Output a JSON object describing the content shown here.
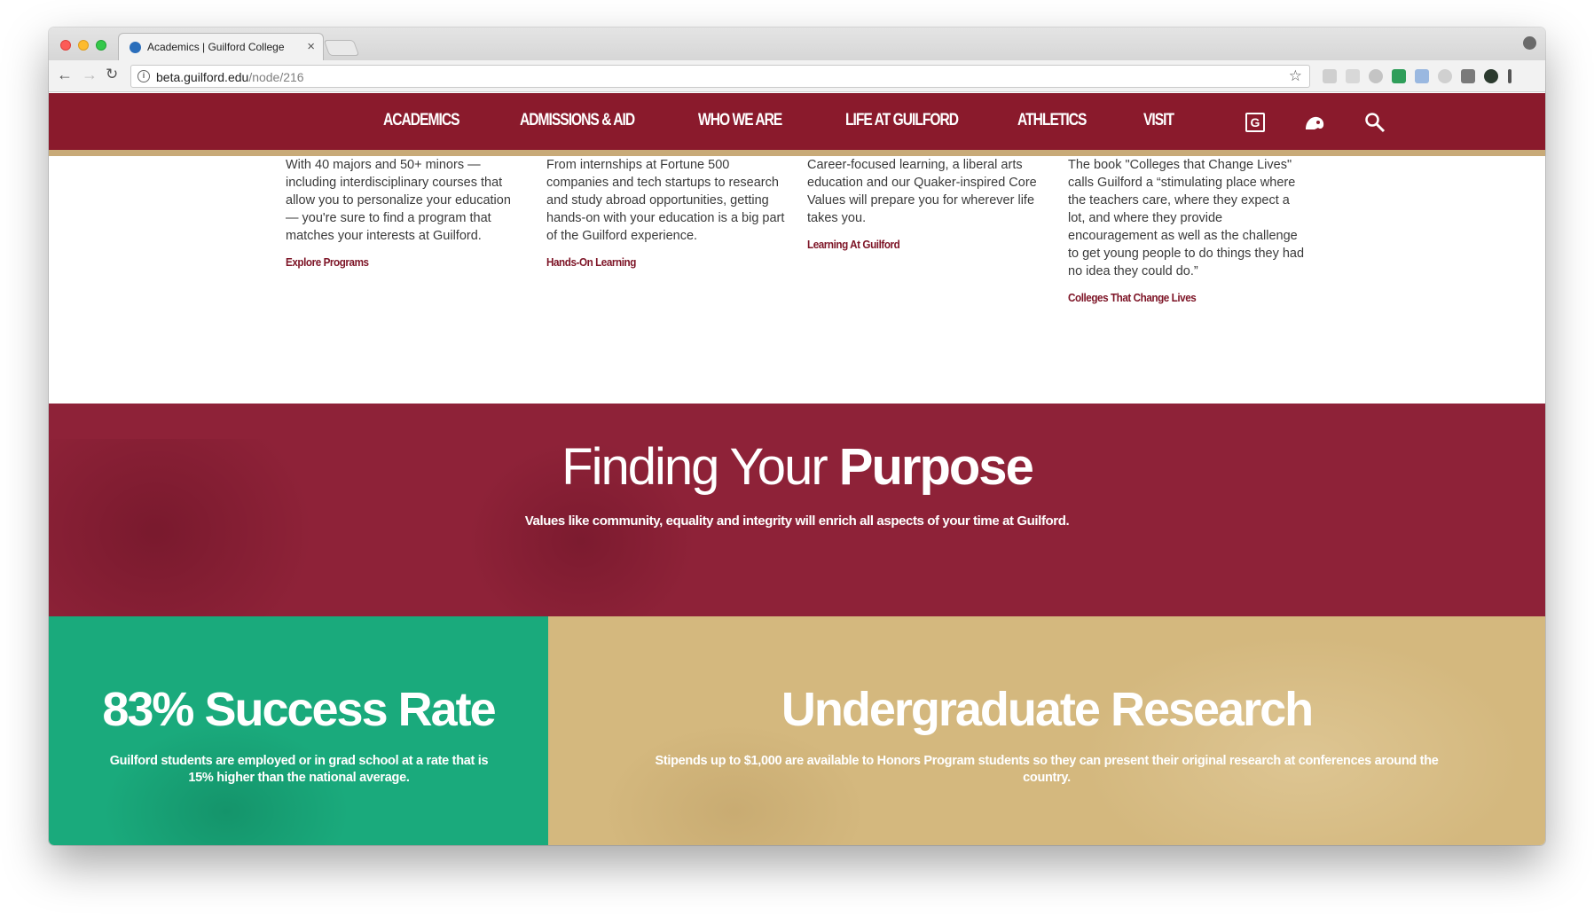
{
  "browser": {
    "tab_title": "Academics | Guilford College",
    "tab_close": "×",
    "url_host": "beta.guilford.edu",
    "url_path": "/node/216",
    "info_icon": "i",
    "back_icon": "←",
    "forward_icon": "→",
    "reload_icon": "↻",
    "star_icon": "☆"
  },
  "nav": {
    "items": [
      "ACADEMICS",
      "ADMISSIONS & AID",
      "WHO WE ARE",
      "LIFE AT GUILFORD",
      "ATHLETICS",
      "VISIT"
    ],
    "g_icon": "G"
  },
  "columns": [
    {
      "text": "With 40 majors and 50+ minors — including interdisciplinary courses that allow you to personalize your education — you're sure to find a program that matches your interests at Guilford.",
      "link": "Explore Programs"
    },
    {
      "text": "From internships at Fortune 500 companies and tech startups to research and study abroad opportunities, getting hands-on with your education is a big part of the Guilford experience.",
      "link": "Hands-On Learning"
    },
    {
      "text": "Career-focused learning, a liberal arts education and our Quaker-inspired Core Values will prepare you for wherever life takes you.",
      "link": "Learning At Guilford"
    },
    {
      "text": "The book \"Colleges that Change Lives\" calls Guilford a “stimulating place where the teachers care, where they expect a lot, and where they provide encouragement as well as the challenge to get young people to do things they had no idea they could do.”",
      "link": "Colleges That Change Lives"
    }
  ],
  "purpose": {
    "title_light": "Finding Your ",
    "title_bold": "Purpose",
    "subtitle": "Values like community, equality and integrity will enrich all aspects of your time at Guilford."
  },
  "success": {
    "title_bold": "83%",
    "title_light": " Success Rate",
    "subtitle": "Guilford students are employed or in grad school at a rate that is 15% higher than the national average."
  },
  "research": {
    "title_light": "Undergraduate ",
    "title_bold": "Research",
    "subtitle": "Stipends up to $1,000 are available to Honors Program students so they can present their original research at conferences around the country."
  },
  "colors": {
    "brand_maroon": "#8a1a2c",
    "accent_gold": "#c8aa78",
    "success_green": "#1aaa7c",
    "research_tan": "#d4b87e"
  }
}
